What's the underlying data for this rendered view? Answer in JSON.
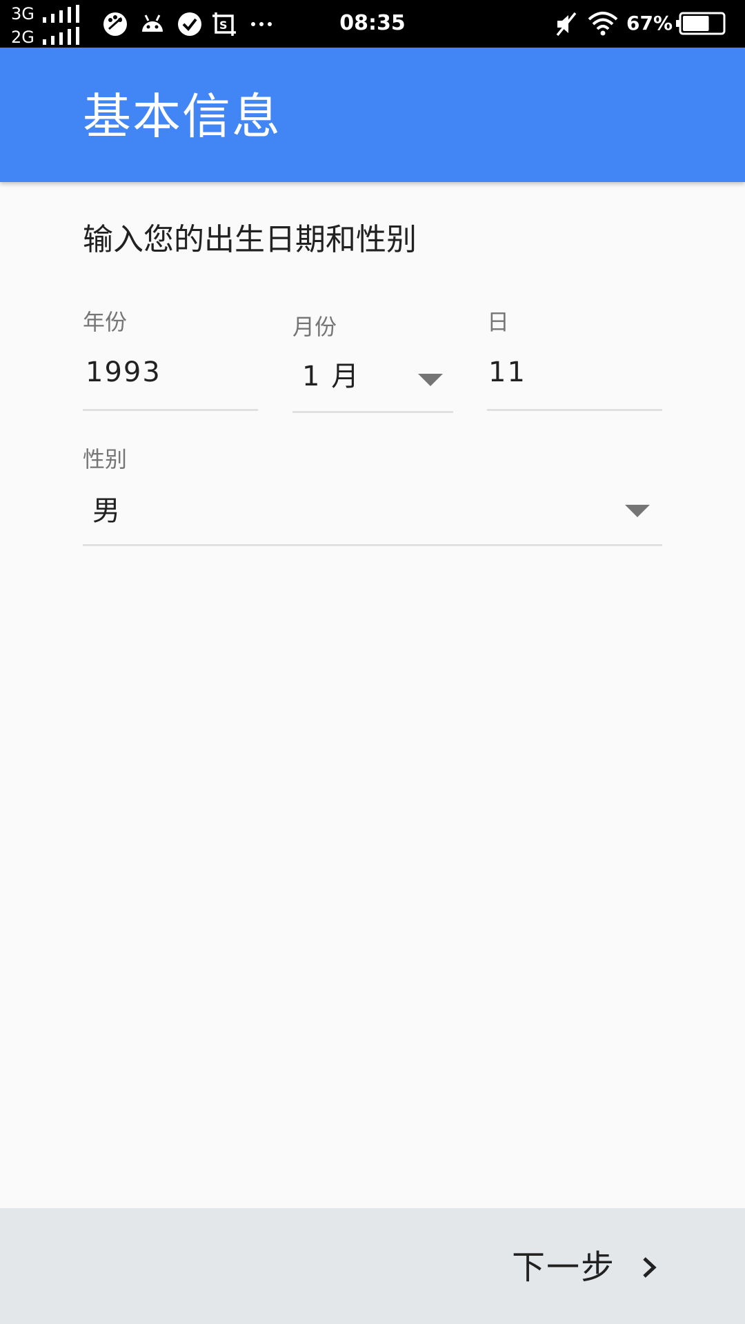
{
  "status_bar": {
    "network_1": "3G",
    "network_2": "2G",
    "time": "08:35",
    "battery_percent": "67%",
    "notification_icons": [
      "palette-icon",
      "android-icon",
      "check-circle-icon",
      "screenshot-icon",
      "more-dots-icon"
    ],
    "battery_level": 0.67
  },
  "app_bar": {
    "title": "基本信息",
    "color": "#4285f4"
  },
  "form": {
    "subtitle": "输入您的出生日期和性别",
    "year": {
      "label": "年份",
      "value": "1993"
    },
    "month": {
      "label": "月份",
      "value": "1 月",
      "selected": "1 月"
    },
    "day": {
      "label": "日",
      "value": "11"
    },
    "gender": {
      "label": "性别",
      "value": "男",
      "selected": "男"
    }
  },
  "footer": {
    "next_label": "下一步",
    "background": "#e4e7ea"
  }
}
